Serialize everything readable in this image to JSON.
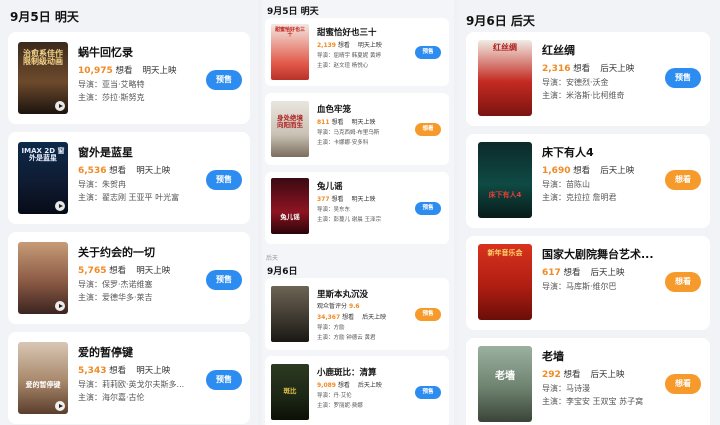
{
  "panel1": {
    "date": "9月5日 明天",
    "movies": [
      {
        "title": "蜗牛回忆录",
        "want": "10,975",
        "want_label": "想看",
        "status": "明天上映",
        "director": "导演：亚当·艾略特",
        "cast": "主演：莎拉·斯努克",
        "button": "预售",
        "poster_text": "治愈系佳作 限制级动画"
      },
      {
        "title": "窗外是蓝星",
        "want": "6,536",
        "want_label": "想看",
        "status": "明天上映",
        "director": "导演：朱贺冉",
        "cast": "主演：翟志刚 王亚平 叶光富",
        "button": "预售",
        "poster_text": "IMAX 2D 窗外是蓝星"
      },
      {
        "title": "关于约会的一切",
        "want": "5,765",
        "want_label": "想看",
        "status": "明天上映",
        "director": "导演：保罗·杰诺维塞",
        "cast": "主演：爱德华多·莱吉",
        "button": "预售",
        "poster_text": ""
      },
      {
        "title": "爱的暂停键",
        "want": "5,343",
        "want_label": "想看",
        "status": "明天上映",
        "director": "导演：莉莉欧·英戈尔夫斯多...",
        "cast": "主演：海尔嘉·古伦",
        "button": "预售",
        "poster_text": "爱的暂停键"
      }
    ]
  },
  "panel2": {
    "date": "9月5日 明天",
    "section_label": "后天",
    "date2": "9月6日",
    "movies_a": [
      {
        "title": "甜蜜恰好也三十",
        "want": "2,139",
        "want_label": "想看",
        "status": "明天上映",
        "director": "导演：屈晴宇 韩夏妮 黄婷",
        "cast": "主演：赵文瑄 杨悦心",
        "button": "预售",
        "poster_text": "甜蜜恰好也三十"
      },
      {
        "title": "血色牢笼",
        "want": "811",
        "want_label": "想看",
        "status": "明天上映",
        "director": "导演：马克西姆·布里乌斯",
        "cast": "主演：卡娜娜·安多科",
        "button": "想看",
        "poster_text": "身处绝境 向阳而生"
      },
      {
        "title": "兔儿谣",
        "want": "377",
        "want_label": "想看",
        "status": "明天上映",
        "director": "导演：吴东东",
        "cast": "主演：彭蔓儿 谢晨 王泽宗",
        "button": "预售",
        "poster_text": "兔儿谣"
      }
    ],
    "movies_b": [
      {
        "title": "里斯本丸沉没",
        "score_label": "观众暂评分",
        "score": "9.6",
        "want": "34,367",
        "want_label": "想看",
        "status": "后天上映",
        "director": "导演：方励",
        "cast": "主演：方励 钟德云 黄君",
        "button": "预售",
        "poster_text": ""
      },
      {
        "title": "小鹿斑比：清算",
        "want": "9,089",
        "want_label": "想看",
        "status": "后天上映",
        "director": "导演：丹·艾伦",
        "cast": "主演：罗丽妮·费娜",
        "button": "预售",
        "poster_text": "斑比"
      }
    ]
  },
  "panel3": {
    "date": "9月6日 后天",
    "movies": [
      {
        "title": "红丝绸",
        "want": "2,316",
        "want_label": "想看",
        "status": "后天上映",
        "director": "导演：安德烈·沃金",
        "cast": "主演：米洛斯·比柯维奇",
        "button": "预售",
        "poster_text": "红丝绸"
      },
      {
        "title": "床下有人4",
        "want": "1,690",
        "want_label": "想看",
        "status": "后天上映",
        "director": "导演：苗陈山",
        "cast": "主演：克拉拉 詹明君",
        "button": "想看",
        "poster_text": "床下有人4"
      },
      {
        "title": "国家大剧院舞台艺术...",
        "want": "617",
        "want_label": "想看",
        "status": "后天上映",
        "director": "导演：马库斯·维尔巴",
        "cast": "",
        "button": "想看",
        "poster_text": "新年音乐会"
      },
      {
        "title": "老墙",
        "want": "292",
        "want_label": "想看",
        "status": "后天上映",
        "director": "导演：马诗漫",
        "cast": "主演：李宝安 王双宝 苏子窝",
        "button": "想看",
        "poster_text": "老墙"
      }
    ]
  },
  "colors": {
    "accent_blue": "#2d8cf0",
    "accent_orange": "#f59a2b",
    "want_number": "#f08a24"
  }
}
